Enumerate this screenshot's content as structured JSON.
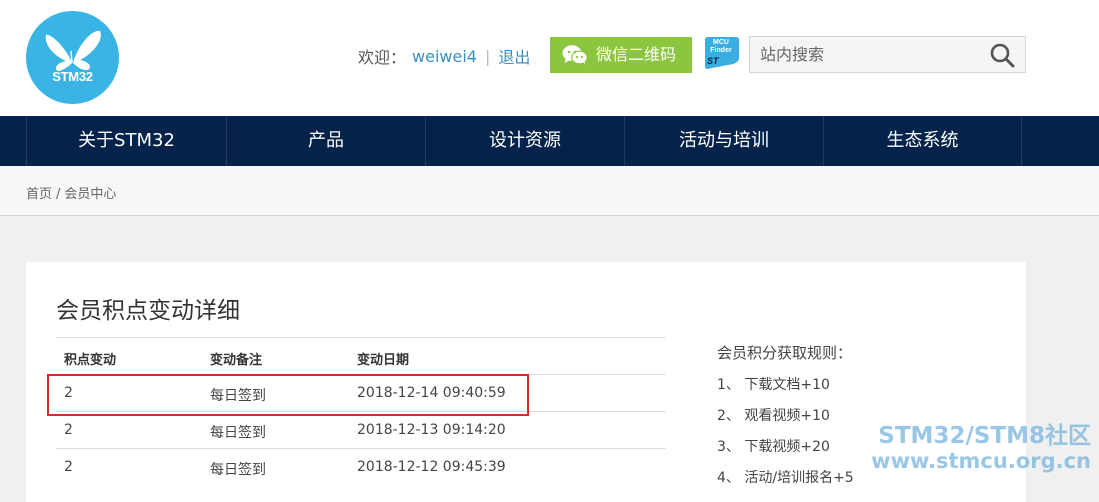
{
  "brand": {
    "logo_text": "STM32"
  },
  "header": {
    "welcome": "欢迎：",
    "username": "weiwei4",
    "separator": "|",
    "logout": "退出",
    "wechat_button": "微信二维码",
    "mcu_finder_line1": "MCU",
    "mcu_finder_line2": "Finder",
    "search_placeholder": "站内搜索"
  },
  "nav": {
    "items": [
      {
        "label": "关于STM32"
      },
      {
        "label": "产品"
      },
      {
        "label": "设计资源"
      },
      {
        "label": "活动与培训"
      },
      {
        "label": "生态系统"
      }
    ]
  },
  "breadcrumb": {
    "home": "首页",
    "slash": "/",
    "current": "会员中心"
  },
  "main": {
    "title": "会员积点变动详细",
    "columns": [
      "积点变动",
      "变动备注",
      "变动日期"
    ],
    "rows": [
      {
        "change": "2",
        "note": "每日签到",
        "date": "2018-12-14 09:40:59"
      },
      {
        "change": "2",
        "note": "每日签到",
        "date": "2018-12-13 09:14:20"
      },
      {
        "change": "2",
        "note": "每日签到",
        "date": "2018-12-12 09:45:39"
      }
    ]
  },
  "rules": {
    "title": "会员积分获取规则：",
    "items": [
      "1、 下载文档+10",
      "2、 观看视频+10",
      "3、 下载视频+20",
      "4、 活动/培训报名+5"
    ]
  },
  "watermark": {
    "line1": "STM32/STM8社区",
    "line2": "www.stmcu.org.cn"
  },
  "colors": {
    "nav_bg": "#03234b",
    "brand_blue": "#3ab4e4",
    "link": "#3a8fc2",
    "wechat_green": "#8cc63e",
    "highlight_red": "#d62b2b"
  }
}
